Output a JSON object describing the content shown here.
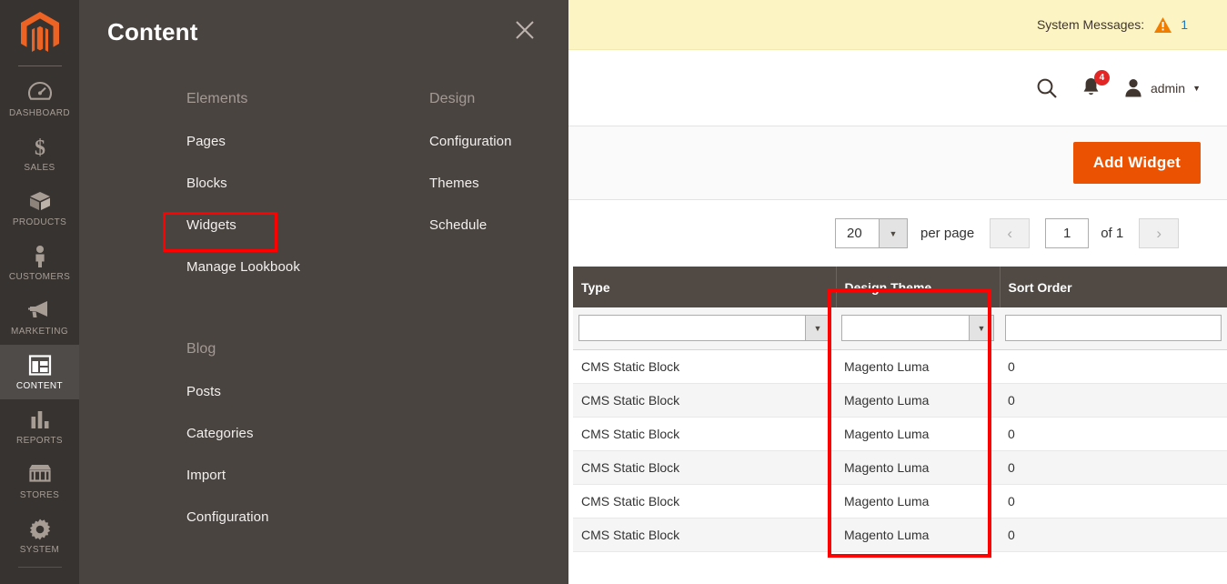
{
  "sidebar": {
    "logo_icon": "magento-logo-icon",
    "items": [
      {
        "label": "DASHBOARD",
        "icon": "dashboard-icon",
        "active": false
      },
      {
        "label": "SALES",
        "icon": "sales-icon",
        "active": false
      },
      {
        "label": "PRODUCTS",
        "icon": "products-icon",
        "active": false
      },
      {
        "label": "CUSTOMERS",
        "icon": "customers-icon",
        "active": false
      },
      {
        "label": "MARKETING",
        "icon": "marketing-icon",
        "active": false
      },
      {
        "label": "CONTENT",
        "icon": "content-icon",
        "active": true
      },
      {
        "label": "REPORTS",
        "icon": "reports-icon",
        "active": false
      },
      {
        "label": "STORES",
        "icon": "stores-icon",
        "active": false
      },
      {
        "label": "SYSTEM",
        "icon": "system-icon",
        "active": false
      }
    ]
  },
  "menu_panel": {
    "title": "Content",
    "close_icon": "close-icon",
    "columns": [
      {
        "heading": "Elements",
        "links": [
          "Pages",
          "Blocks",
          "Widgets",
          "Manage Lookbook"
        ]
      },
      {
        "heading": "Design",
        "links": [
          "Configuration",
          "Themes",
          "Schedule"
        ]
      }
    ],
    "blog": {
      "heading": "Blog",
      "links": [
        "Posts",
        "Categories",
        "Import",
        "Configuration"
      ]
    }
  },
  "highlights": {
    "widgets_box_color": "#ff0000",
    "design_theme_box_color": "#ff0000"
  },
  "system_messages": {
    "label": "System Messages:",
    "warning_icon": "warning-triangle-icon",
    "count": "1",
    "count_color": "#1979c3",
    "bar_color": "#fdf4c3"
  },
  "admin_bar": {
    "search_icon": "search-icon",
    "notifications_icon": "bell-icon",
    "notifications_count": "4",
    "badge_color": "#e22626",
    "user_icon": "user-avatar-icon",
    "user_name": "admin",
    "caret_icon": "chevron-down-icon"
  },
  "page_actions": {
    "add_widget_label": "Add Widget",
    "add_widget_color": "#eb5202"
  },
  "pager": {
    "per_page_value": "20",
    "per_page_label": "per page",
    "prev_icon": "chevron-left-icon",
    "next_icon": "chevron-right-icon",
    "current_page": "1",
    "of_label": "of 1"
  },
  "grid": {
    "columns": [
      {
        "header": "Type",
        "filter": "select"
      },
      {
        "header": "Design Theme",
        "filter": "select"
      },
      {
        "header": "Sort Order",
        "filter": "text"
      }
    ],
    "filters": {
      "type": "",
      "design_theme": "",
      "sort_order": ""
    },
    "rows": [
      {
        "type": "CMS Static Block",
        "design_theme": "Magento Luma",
        "sort_order": "0"
      },
      {
        "type": "CMS Static Block",
        "design_theme": "Magento Luma",
        "sort_order": "0"
      },
      {
        "type": "CMS Static Block",
        "design_theme": "Magento Luma",
        "sort_order": "0"
      },
      {
        "type": "CMS Static Block",
        "design_theme": "Magento Luma",
        "sort_order": "0"
      },
      {
        "type": "CMS Static Block",
        "design_theme": "Magento Luma",
        "sort_order": "0"
      },
      {
        "type": "CMS Static Block",
        "design_theme": "Magento Luma",
        "sort_order": "0"
      }
    ]
  }
}
